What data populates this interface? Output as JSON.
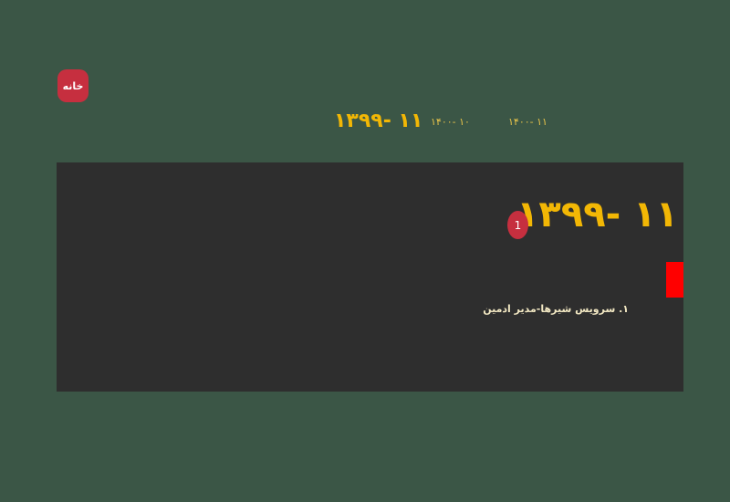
{
  "nav": {
    "home_label": "خانه"
  },
  "periods": [
    {
      "label": "۱۱ -۱۳۹۹"
    },
    {
      "label": "۱۰ -۱۴۰۰"
    },
    {
      "label": "۱۱ -۱۴۰۰"
    }
  ],
  "panel": {
    "title": "۱۱ -۱۳۹۹",
    "badge_count": "1",
    "items": [
      {
        "label": "۱. سرویس شیرها-مدیر ادمین"
      }
    ]
  },
  "colors": {
    "background": "#3b5646",
    "panel": "#2e2e2e",
    "accent_gold": "#f2b705",
    "badge_red": "#c62f3f",
    "marker_red": "#ff0000"
  }
}
